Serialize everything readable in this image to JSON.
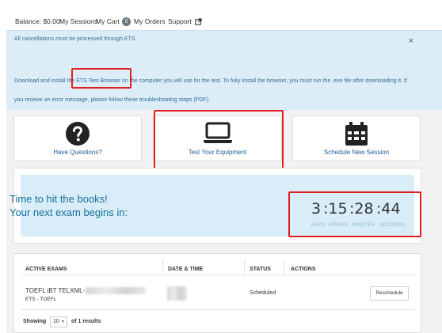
{
  "nav": {
    "balance": "Balance: $0.00",
    "sessions": "My Sessions",
    "cart": "My Cart",
    "cart_count": "0",
    "orders": "My Orders",
    "support": "Support"
  },
  "alert": {
    "line1": "All cancellations must be processed through ETS.",
    "close": "×",
    "line2_pre": "Download and install the ",
    "line2_link": "ETS Test Browser",
    "line2_post": " on the computer you will use for the test. To fully install the browser, you must run the .exe file after downloading it. If",
    "line3_pre": "you receive an error message, please follow these ",
    "line3_link": "troubleshooting steps (PDF)",
    "line3_post": "."
  },
  "cards": [
    {
      "label": "Have Questions?",
      "icon": "question-circle-icon"
    },
    {
      "label": "Test Your Equipment",
      "icon": "laptop-icon"
    },
    {
      "label": "Schedule New Session",
      "icon": "calendar-icon"
    }
  ],
  "countdown": {
    "title1": "Time to hit the books!",
    "title2": "Your next exam begins in:",
    "days": "3",
    "hours": ":15",
    "minutes": ":28",
    "seconds": ":44",
    "label_days": "DAYS",
    "label_hours": "HOURS",
    "label_minutes": "MINUTES",
    "label_seconds": "SECONDS"
  },
  "table": {
    "headers": [
      "ACTIVE EXAMS",
      "DATE & TIME",
      "STATUS",
      "ACTIONS"
    ],
    "row": {
      "exam": "TOEFL iBT TELXML-",
      "provider": "ETS - TOEFL",
      "status": "Scheduled",
      "action": "Reschedule"
    },
    "showing_label": "Showing",
    "page_size": "10",
    "results": "of 1 results"
  },
  "colors": {
    "accent": "#1f5d96",
    "alert_bg": "#dcedf7",
    "highlight": "#e02020"
  }
}
